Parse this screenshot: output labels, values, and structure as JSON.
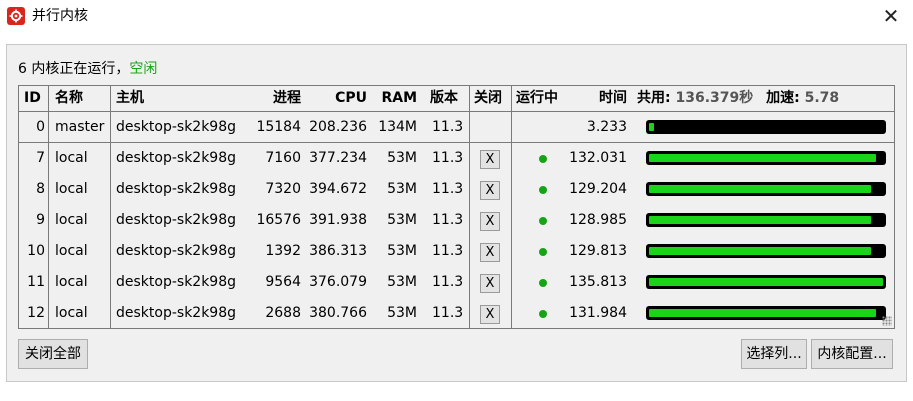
{
  "window": {
    "title": "并行内核",
    "close_glyph": "✕"
  },
  "status": {
    "prefix": "6 内核正在运行，",
    "state": "空闲"
  },
  "table": {
    "headers": {
      "id": "ID",
      "name": "名称",
      "host": "主机",
      "process": "进程",
      "cpu": "CPU",
      "ram": "RAM",
      "version": "版本",
      "close": "关闭",
      "running": "运行中",
      "time": "时间",
      "total_label": "共用:",
      "total_value": "136.379秒",
      "speedup_label": "加速:",
      "speedup_value": "5.78"
    },
    "close_button_label": "X",
    "rows": [
      {
        "id": "0",
        "name": "master",
        "host": "desktop-sk2k98g",
        "process": "15184",
        "cpu": "208.236",
        "ram": "134M",
        "version": "11.3",
        "time": "3.233",
        "progress": 0.02,
        "closable": false,
        "running": false
      },
      {
        "id": "7",
        "name": "local",
        "host": "desktop-sk2k98g",
        "process": "7160",
        "cpu": "377.234",
        "ram": "53M",
        "version": "11.3",
        "time": "132.031",
        "progress": 0.97,
        "closable": true,
        "running": true
      },
      {
        "id": "8",
        "name": "local",
        "host": "desktop-sk2k98g",
        "process": "7320",
        "cpu": "394.672",
        "ram": "53M",
        "version": "11.3",
        "time": "129.204",
        "progress": 0.95,
        "closable": true,
        "running": true
      },
      {
        "id": "9",
        "name": "local",
        "host": "desktop-sk2k98g",
        "process": "16576",
        "cpu": "391.938",
        "ram": "53M",
        "version": "11.3",
        "time": "128.985",
        "progress": 0.95,
        "closable": true,
        "running": true
      },
      {
        "id": "10",
        "name": "local",
        "host": "desktop-sk2k98g",
        "process": "1392",
        "cpu": "386.313",
        "ram": "53M",
        "version": "11.3",
        "time": "129.813",
        "progress": 0.95,
        "closable": true,
        "running": true
      },
      {
        "id": "11",
        "name": "local",
        "host": "desktop-sk2k98g",
        "process": "9564",
        "cpu": "376.079",
        "ram": "53M",
        "version": "11.3",
        "time": "135.813",
        "progress": 1.0,
        "closable": true,
        "running": true
      },
      {
        "id": "12",
        "name": "local",
        "host": "desktop-sk2k98g",
        "process": "2688",
        "cpu": "380.766",
        "ram": "53M",
        "version": "11.3",
        "time": "131.984",
        "progress": 0.97,
        "closable": true,
        "running": true
      }
    ]
  },
  "buttons": {
    "close_all": "关闭全部",
    "select_columns": "选择列...",
    "kernel_config": "内核配置..."
  },
  "colors": {
    "accent_icon": "#d9261c",
    "idle_text": "#1aa31a",
    "progress_fill": "#19d419",
    "running_dot": "#16a416"
  }
}
